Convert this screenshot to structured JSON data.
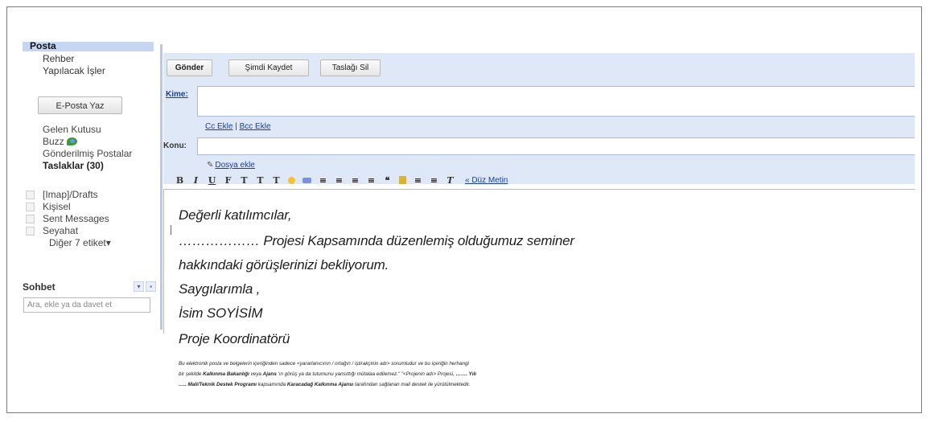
{
  "sidebar": {
    "active": "Posta",
    "links": [
      "Rehber",
      "Yapılacak İşler"
    ],
    "compose_button": "E-Posta Yaz",
    "folders": [
      {
        "label": "Gelen Kutusu",
        "bold": false
      },
      {
        "label": "Buzz",
        "bold": false,
        "icon": "buzz-icon"
      },
      {
        "label": "Gönderilmiş Postalar",
        "bold": false
      },
      {
        "label": "Taslaklar (30)",
        "bold": true
      }
    ],
    "labels": [
      "[Imap]/Drafts",
      "Kişisel",
      "Sent Messages",
      "Seyahat"
    ],
    "more_labels": "Diğer 7 etiket▾",
    "chat": {
      "title": "Sohbet",
      "controls": [
        "▾",
        "▪"
      ],
      "placeholder": "Ara, ekle ya da davet et"
    }
  },
  "compose": {
    "buttons": [
      "Gönder",
      "Şimdi Kaydet",
      "Taslağı Sil"
    ],
    "to_label": "Kime:",
    "cc_link": "Cc Ekle",
    "cc_sep": " | ",
    "bcc_link": "Bcc Ekle",
    "subject_label": "Konu:",
    "attach_link": "Dosya ekle",
    "formatting": [
      "B",
      "I",
      "U",
      "F",
      "T",
      "T",
      "T",
      "☺",
      "∞",
      "≡",
      "≡",
      "≡",
      "≡",
      "❝",
      "≡",
      "≡",
      "≡",
      "T"
    ],
    "plain_text_link": "« Düz Metin"
  },
  "message": {
    "lines": [
      "Değerli katılımcılar,",
      "……………… Projesi Kapsamında düzenlemiş olduğumuz seminer",
      "hakkındaki görüşlerinizi bekliyorum.",
      "Saygılarımla ,",
      "İsim SOYİSİM",
      "Proje Koordinatörü"
    ],
    "disclaimer": {
      "p1": "Bu elektronik posta ve belgelerin içeriğinden sadece <yararlanıcının / ortağın / iştirakçinin adı> sorumludur ve bu içeriğin herhangi",
      "p2a": "bir şekilde ",
      "p2b": "Kalkınma Bakanlığı",
      "p2c": " veya ",
      "p2d": "Ajans",
      "p2e": " 'ın görüş ya da tutumunu yansıttığı mütalaa edilemez.\" \"<Projenin adı> Projesi, ",
      "p2f": "……. Yılı",
      "p3a": "….. Mali/Teknik Destek Programı",
      "p3b": " kapsamında ",
      "p3c": "Karacadağ Kalkınma Ajansı",
      "p3d": " tarafından  sağlanan mali destek ile yürütülmektedir."
    }
  }
}
